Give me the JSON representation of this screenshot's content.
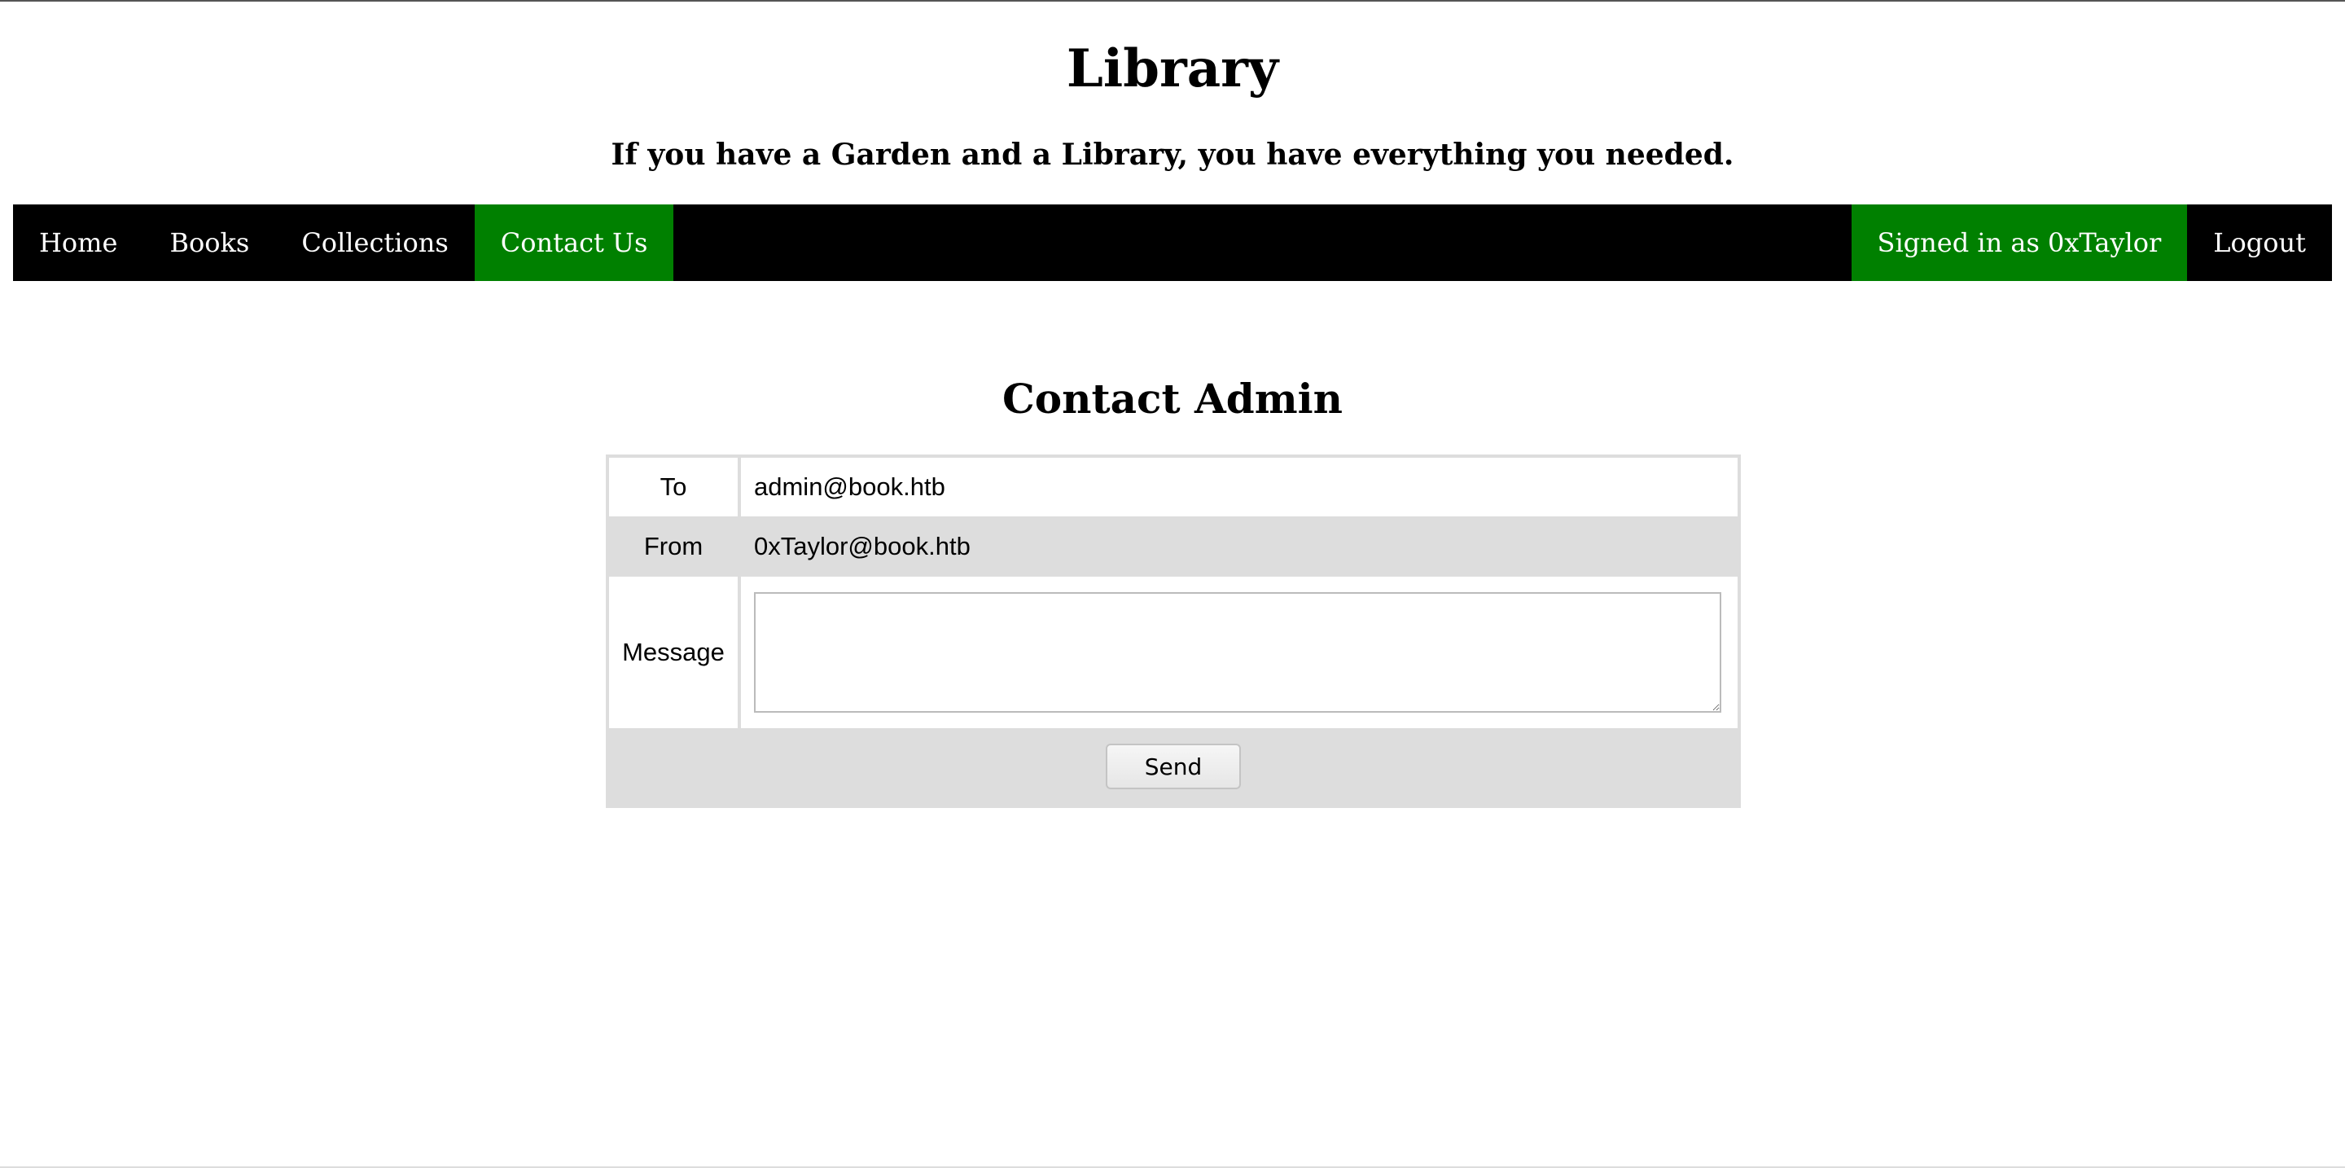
{
  "header": {
    "title": "Library",
    "tagline": "If you have a Garden and a Library, you have everything you needed."
  },
  "nav": {
    "items": [
      {
        "label": "Home",
        "active": false
      },
      {
        "label": "Books",
        "active": false
      },
      {
        "label": "Collections",
        "active": false
      },
      {
        "label": "Contact Us",
        "active": true
      }
    ],
    "signed_in_label": "Signed in as 0xTaylor",
    "logout_label": "Logout"
  },
  "contact": {
    "heading": "Contact Admin",
    "to_label": "To",
    "to_value": "admin@book.htb",
    "from_label": "From",
    "from_value": "0xTaylor@book.htb",
    "message_label": "Message",
    "message_value": "",
    "send_label": "Send"
  },
  "colors": {
    "nav_background": "#000000",
    "nav_active": "#008000",
    "table_stripe": "#dddddd"
  }
}
